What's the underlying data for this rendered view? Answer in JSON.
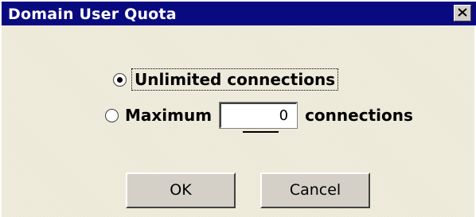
{
  "dialog": {
    "title": "Domain User Quota",
    "close_icon": "close-x-icon"
  },
  "options": {
    "unlimited_label": "Unlimited connections",
    "maximum_label": "Maximum",
    "maximum_value": "0",
    "connections_suffix": "connections",
    "selected": "unlimited"
  },
  "buttons": {
    "ok_label": "OK",
    "cancel_label": "Cancel"
  },
  "colors": {
    "titlebar": "#0a0a80",
    "face": "#d4d0c8",
    "background": "#ece9d8"
  }
}
